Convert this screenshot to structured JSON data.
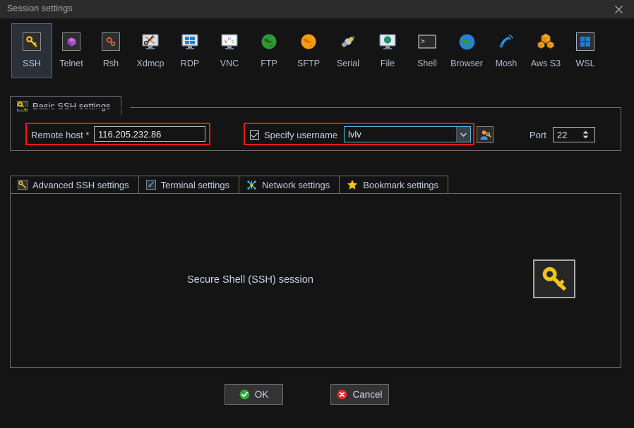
{
  "window": {
    "title": "Session settings",
    "close_icon": "close-icon"
  },
  "toolbar": {
    "items": [
      {
        "label": "SSH",
        "icon": "key-icon",
        "selected": true
      },
      {
        "label": "Telnet",
        "icon": "cube-icon",
        "selected": false
      },
      {
        "label": "Rsh",
        "icon": "gears-icon",
        "selected": false
      },
      {
        "label": "Xdmcp",
        "icon": "monitor-x-icon",
        "selected": false
      },
      {
        "label": "RDP",
        "icon": "windows-monitor-icon",
        "selected": false
      },
      {
        "label": "VNC",
        "icon": "vnc-monitor-icon",
        "selected": false
      },
      {
        "label": "FTP",
        "icon": "green-globe-icon",
        "selected": false
      },
      {
        "label": "SFTP",
        "icon": "orange-globe-icon",
        "selected": false
      },
      {
        "label": "Serial",
        "icon": "serial-plug-icon",
        "selected": false
      },
      {
        "label": "File",
        "icon": "file-monitor-icon",
        "selected": false
      },
      {
        "label": "Shell",
        "icon": "terminal-icon",
        "selected": false
      },
      {
        "label": "Browser",
        "icon": "blue-globe-icon",
        "selected": false
      },
      {
        "label": "Mosh",
        "icon": "satellite-icon",
        "selected": false
      },
      {
        "label": "Aws S3",
        "icon": "aws-cubes-icon",
        "selected": false
      },
      {
        "label": "WSL",
        "icon": "windows-icon",
        "selected": false
      }
    ]
  },
  "basic_group": {
    "tab_label": "Basic SSH settings",
    "tab_icon": "key-icon",
    "remote_host": {
      "label": "Remote host *",
      "value": "116.205.232.86",
      "placeholder": ""
    },
    "specify_username": {
      "label": "Specify username",
      "checked": true,
      "value": "lvlv",
      "placeholder": "",
      "dropdown_icon": "chevron-down-icon"
    },
    "user_button_icon": "user-key-icon",
    "port": {
      "label": "Port",
      "value": "22"
    }
  },
  "settings_tabs": [
    {
      "label": "Advanced SSH settings",
      "icon": "key-icon"
    },
    {
      "label": "Terminal settings",
      "icon": "terminal-settings-icon"
    },
    {
      "label": "Network settings",
      "icon": "network-icon"
    },
    {
      "label": "Bookmark settings",
      "icon": "star-icon"
    }
  ],
  "panel": {
    "text": "Secure Shell (SSH) session",
    "icon": "key-icon"
  },
  "buttons": {
    "ok": {
      "label": "OK",
      "icon": "check-circle-icon"
    },
    "cancel": {
      "label": "Cancel",
      "icon": "x-circle-icon"
    }
  },
  "colors": {
    "background": "#141414",
    "titlebar": "#2b2b2b",
    "border": "#6c6c6c",
    "accent_text": "#c3cfe2",
    "highlight_outline": "#f31818",
    "selected_tab_bg": "#2a2f38",
    "combo_border": "#57b7d8",
    "key_yellow": "#f0c419",
    "ok_green": "#34a83a",
    "cancel_red": "#e02a2a"
  }
}
